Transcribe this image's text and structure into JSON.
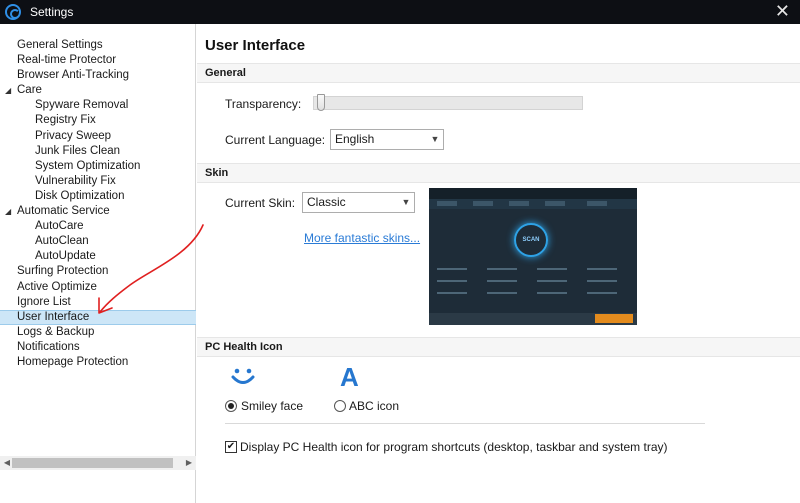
{
  "window": {
    "title": "Settings",
    "close_glyph": "✕"
  },
  "sidebar": {
    "items": [
      {
        "label": "General Settings"
      },
      {
        "label": "Real-time Protector"
      },
      {
        "label": "Browser Anti-Tracking"
      },
      {
        "label": "Care"
      },
      {
        "label": "Spyware Removal"
      },
      {
        "label": "Registry Fix"
      },
      {
        "label": "Privacy Sweep"
      },
      {
        "label": "Junk Files Clean"
      },
      {
        "label": "System Optimization"
      },
      {
        "label": "Vulnerability Fix"
      },
      {
        "label": "Disk Optimization"
      },
      {
        "label": "Automatic Service"
      },
      {
        "label": "AutoCare"
      },
      {
        "label": "AutoClean"
      },
      {
        "label": "AutoUpdate"
      },
      {
        "label": "Surfing Protection"
      },
      {
        "label": "Active Optimize"
      },
      {
        "label": "Ignore List"
      },
      {
        "label": "User Interface"
      },
      {
        "label": "Logs & Backup"
      },
      {
        "label": "Notifications"
      },
      {
        "label": "Homepage Protection"
      }
    ],
    "selected": "User Interface"
  },
  "main": {
    "title": "User Interface",
    "general": {
      "header": "General",
      "transparency_label": "Transparency:",
      "transparency_value": 0.0,
      "language_label": "Current Language:",
      "language_value": "English"
    },
    "skin": {
      "header": "Skin",
      "current_skin_label": "Current Skin:",
      "current_skin_value": "Classic",
      "more_skins_link": "More fantastic skins...",
      "preview_scan_text": "SCAN"
    },
    "pc_health": {
      "header": "PC Health Icon",
      "smiley_label": "Smiley face",
      "abc_label": "ABC icon",
      "abc_glyph": "A",
      "selected_option": "Smiley face",
      "shortcut_checkbox_label": "Display PC Health icon for program shortcuts (desktop, taskbar and system tray)",
      "shortcut_checked": true,
      "check_glyph": "✔"
    }
  },
  "colors": {
    "titlebar": "#0d0f14",
    "selection": "#cde6f7",
    "link": "#2a7bd6",
    "accent_blue": "#2677cf",
    "annotation_red": "#e02020"
  },
  "icons": {
    "app_logo": "app-logo-icon",
    "close": "close-icon",
    "smiley": "smiley-icon",
    "abc": "abc-icon"
  }
}
